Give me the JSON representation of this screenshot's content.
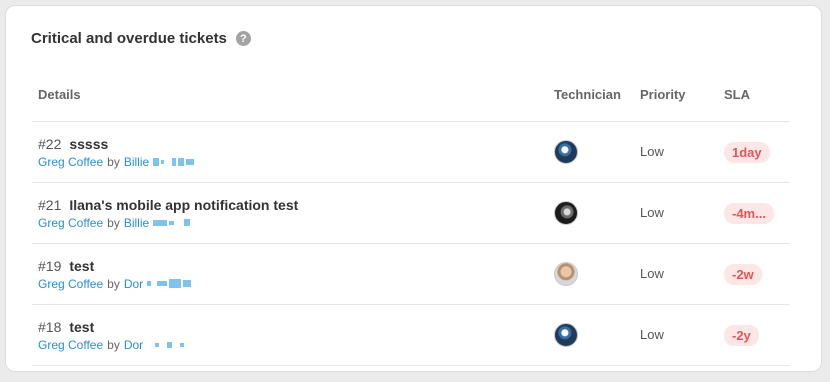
{
  "widget": {
    "title": "Critical and overdue tickets",
    "help_icon": "help-circle-icon"
  },
  "table": {
    "headers": {
      "details": "Details",
      "technician": "Technician",
      "priority": "Priority",
      "sla": "SLA"
    },
    "rows": [
      {
        "id": "#22",
        "title": "sssss",
        "requester": "Greg Coffee",
        "by": "by",
        "assignee": "Billie",
        "technician_avatar": "planet-avatar",
        "priority": "Low",
        "sla": "1day"
      },
      {
        "id": "#21",
        "title": "Ilana's mobile app notification test",
        "requester": "Greg Coffee",
        "by": "by",
        "assignee": "Billie",
        "technician_avatar": "dark-avatar",
        "priority": "Low",
        "sla": "-4m..."
      },
      {
        "id": "#19",
        "title": "test",
        "requester": "Greg Coffee",
        "by": "by",
        "assignee": "Dor",
        "technician_avatar": "face-avatar",
        "priority": "Low",
        "sla": "-2w"
      },
      {
        "id": "#18",
        "title": "test",
        "requester": "Greg Coffee",
        "by": "by",
        "assignee": "Dor",
        "technician_avatar": "planet-avatar",
        "priority": "Low",
        "sla": "-2y"
      }
    ]
  },
  "colors": {
    "link": "#2a8fd6",
    "sla_text": "#e25555",
    "sla_bg": "#fde6e6"
  }
}
